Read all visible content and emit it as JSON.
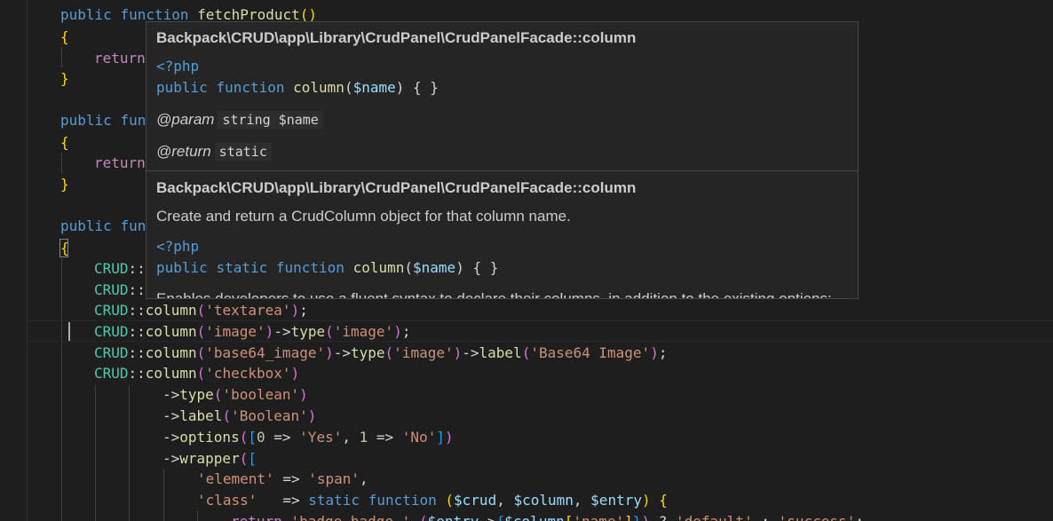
{
  "code": {
    "l1": {
      "kw": "public",
      "kw2": "function",
      "fn": "fetchProduct",
      "paren": "()"
    },
    "l2": "{",
    "l3": "return",
    "l4": "}",
    "l5": {
      "kw": "public",
      "fn": "fun"
    },
    "l6": "{",
    "l7": "return",
    "l8": "}",
    "l9": {
      "kw": "public",
      "fn": "fun"
    },
    "l10": "{",
    "l11": {
      "cls": "CRUD",
      "op": "::"
    },
    "l12": {
      "cls": "CRUD",
      "op": "::"
    },
    "l13": {
      "cls": "CRUD",
      "op": "::",
      "fn": "column",
      "arg": "'textarea'",
      "end": ";"
    },
    "l14": {
      "cls": "CRUD",
      "op": "::",
      "fn": "column",
      "arg": "'image'",
      "arrow": "->",
      "fn2": "type",
      "arg2": "'image'",
      "end": ";"
    },
    "l15": {
      "cls": "CRUD",
      "op": "::",
      "fn": "column",
      "arg": "'base64_image'",
      "arrow": "->",
      "fn2": "type",
      "arg2": "'image'",
      "fn3": "label",
      "arg3": "'Base64 Image'",
      "end": ";"
    },
    "l16": {
      "cls": "CRUD",
      "op": "::",
      "fn": "column",
      "arg": "'checkbox'"
    },
    "l17": {
      "arrow": "->",
      "fn": "type",
      "arg": "'boolean'"
    },
    "l18": {
      "arrow": "->",
      "fn": "label",
      "arg": "'Boolean'"
    },
    "l19": {
      "arrow": "->",
      "fn": "options",
      "n0": "0",
      "fat": "=>",
      "yes": "'Yes'",
      "n1": "1",
      "no": "'No'"
    },
    "l20": {
      "arrow": "->",
      "fn": "wrapper"
    },
    "l21": {
      "key": "'element'",
      "fat": "=>",
      "val": "'span'"
    },
    "l22": {
      "key": "'class'",
      "fat": "=>",
      "kw": "static",
      "kw2": "function",
      "crud": "$crud",
      "column": "$column",
      "entry": "$entry"
    },
    "l23": {
      "ret": "return",
      "s1": "'badge badge-'",
      "entry": "$entry",
      "column": "$column",
      "name": "'name'",
      "def": "'default'",
      "succ": "'success'"
    }
  },
  "hover": {
    "section1": {
      "title": "Backpack\\CRUD\\app\\Library\\CrudPanel\\CrudPanelFacade::column",
      "php_tag": "<?php",
      "sig_kw1": "public",
      "sig_kw2": "function",
      "sig_fn": "column",
      "sig_param": "$name",
      "sig_rest": ") { }",
      "param_tag": "@param",
      "param_value": "string $name",
      "return_tag": "@return",
      "return_value": "static"
    },
    "section2": {
      "title": "Backpack\\CRUD\\app\\Library\\CrudPanel\\CrudPanelFacade::column",
      "description": "Create and return a CrudColumn object for that column name.",
      "php_tag": "<?php",
      "sig_kw1": "public",
      "sig_kw2": "static",
      "sig_kw3": "function",
      "sig_fn": "column",
      "sig_param": "$name",
      "sig_rest": ") { }",
      "more_text": "Enables developers to use a fluent syntax to declare their columns, in addition to the existing options:"
    }
  },
  "colors": {
    "background": "#1e1e1e",
    "hover_background": "#252526",
    "keyword": "#569cd6",
    "function": "#dcdcaa",
    "string": "#ce9178",
    "class": "#4ec9b0"
  }
}
